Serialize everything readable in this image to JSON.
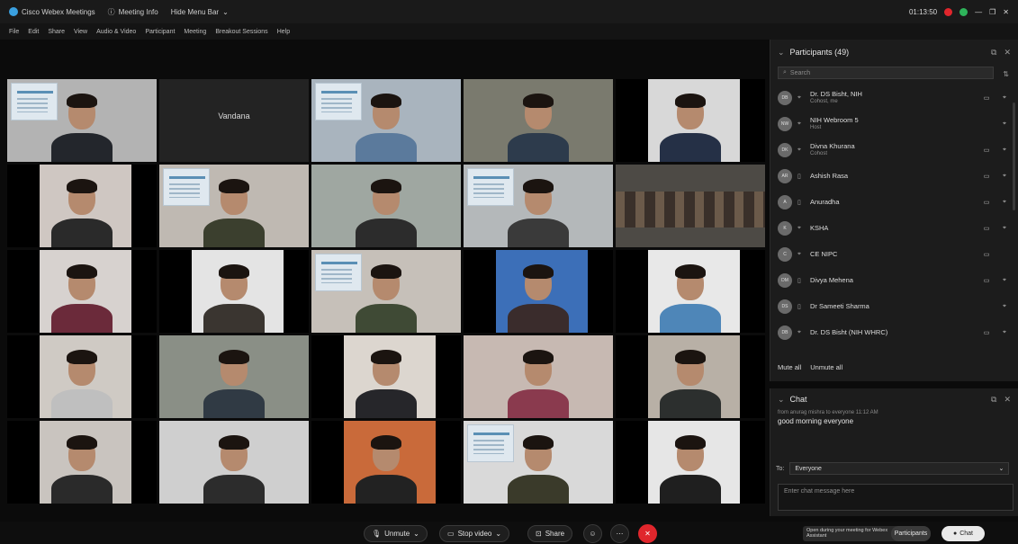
{
  "titlebar": {
    "app": "Cisco Webex Meetings",
    "meeting_info": "Meeting Info",
    "hide_menu": "Hide Menu Bar",
    "time": "01:13:50"
  },
  "menubar": [
    "File",
    "Edit",
    "Share",
    "View",
    "Audio & Video",
    "Participant",
    "Meeting",
    "Breakout Sessions",
    "Help"
  ],
  "tiles": [
    {
      "type": "person-poster",
      "bg": "#b3b3b3",
      "body": "#23262c"
    },
    {
      "type": "name",
      "label": "Vandana",
      "bg": "#232323"
    },
    {
      "type": "person-poster",
      "bg": "#a9b4be",
      "body": "#5b7a9c"
    },
    {
      "type": "person",
      "bg": "#7a7a6e",
      "body": "#2d3b4c"
    },
    {
      "type": "person-black",
      "bg": "#d8d8d8",
      "body": "#253046"
    },
    {
      "type": "person-black",
      "bg": "#cfc7c2",
      "body": "#2a2a2a"
    },
    {
      "type": "person-poster",
      "bg": "#bfb9b2",
      "body": "#3b3f2e"
    },
    {
      "type": "person",
      "bg": "#9fa7a1",
      "body": "#2c2c2c"
    },
    {
      "type": "person-poster",
      "bg": "#b4b8ba",
      "body": "#3a3a3a"
    },
    {
      "type": "room",
      "bg": "#4d4a45",
      "body": "#3a2f28"
    },
    {
      "type": "person-black",
      "bg": "#d7d2cf",
      "body": "#6b2a3a"
    },
    {
      "type": "person-black",
      "bg": "#e4e4e4",
      "body": "#3a3530"
    },
    {
      "type": "person-poster",
      "bg": "#c6c0b9",
      "body": "#3f4a35"
    },
    {
      "type": "person-black",
      "bg": "#3c6fb8",
      "body": "#3a2c2c"
    },
    {
      "type": "person-black",
      "bg": "#e8e8e8",
      "body": "#4e86b8"
    },
    {
      "type": "person-black",
      "bg": "#cfcac4",
      "body": "#bfbfbf"
    },
    {
      "type": "person",
      "bg": "#8a8f86",
      "body": "#303a44"
    },
    {
      "type": "person-black",
      "bg": "#dcd6cf",
      "body": "#26262a"
    },
    {
      "type": "person",
      "bg": "#c7b9b2",
      "body": "#8a3a4e"
    },
    {
      "type": "person-black",
      "bg": "#b8b0a6",
      "body": "#2c2f2e"
    },
    {
      "type": "person-black",
      "bg": "#c9c4bf",
      "body": "#2a2a2a"
    },
    {
      "type": "person",
      "bg": "#cfcfcf",
      "body": "#2c2c2c"
    },
    {
      "type": "person-black",
      "bg": "#c96a3a",
      "body": "#222222"
    },
    {
      "type": "person-poster",
      "bg": "#d9d9d9",
      "body": "#3a3a2a"
    },
    {
      "type": "person-black",
      "bg": "#e6e6e6",
      "body": "#1f1f1f"
    }
  ],
  "participants": {
    "title": "Participants (49)",
    "search_placeholder": "Search",
    "rows": [
      {
        "initials": "DB",
        "name": "Dr. DS Bisht, NIH",
        "sub": "Cohost, me",
        "video": "▭",
        "mic": "⌖",
        "icon": "⌖"
      },
      {
        "initials": "NW",
        "name": "NIH Webroom 5",
        "sub": "Host",
        "video": "",
        "mic": "⌖",
        "icon": "⌖"
      },
      {
        "initials": "DK",
        "name": "Divna Khurana",
        "sub": "Cohost",
        "video": "▭",
        "mic": "⌖",
        "icon": "⌖"
      },
      {
        "initials": "AR",
        "name": "Ashish Rasa",
        "sub": "",
        "video": "▭",
        "mic": "⌖",
        "icon": "▯"
      },
      {
        "initials": "A",
        "name": "Anuradha",
        "sub": "",
        "video": "▭",
        "mic": "⌖",
        "icon": "▯"
      },
      {
        "initials": "K",
        "name": "KSHA",
        "sub": "",
        "video": "▭",
        "mic": "⌖",
        "icon": "⌖"
      },
      {
        "initials": "C",
        "name": "CE NIPC",
        "sub": "",
        "video": "▭",
        "mic": "",
        "icon": "⌖"
      },
      {
        "initials": "DM",
        "name": "Divya Mehena",
        "sub": "",
        "video": "▭",
        "mic": "⌖",
        "icon": "▯"
      },
      {
        "initials": "DS",
        "name": "Dr Sameeti Sharma",
        "sub": "",
        "video": "",
        "mic": "⌖",
        "icon": "▯"
      },
      {
        "initials": "DB",
        "name": "Dr. DS Bisht (NIH WHRC)",
        "sub": "",
        "video": "▭",
        "mic": "⌖",
        "icon": "⌖"
      }
    ],
    "mute_all": "Mute all",
    "unmute_all": "Unmute all"
  },
  "chat": {
    "title": "Chat",
    "meta": "from anurag mishra to everyone    11:12 AM",
    "message": "good morning everyone",
    "to_label": "To:",
    "to_value": "Everyone",
    "input_placeholder": "Enter chat message here"
  },
  "controls": {
    "unmute": "Unmute",
    "stop_video": "Stop video",
    "share": "Share",
    "toast": "Open during your meeting for Webex Assistant",
    "participants": "Participants",
    "chat": "Chat"
  }
}
